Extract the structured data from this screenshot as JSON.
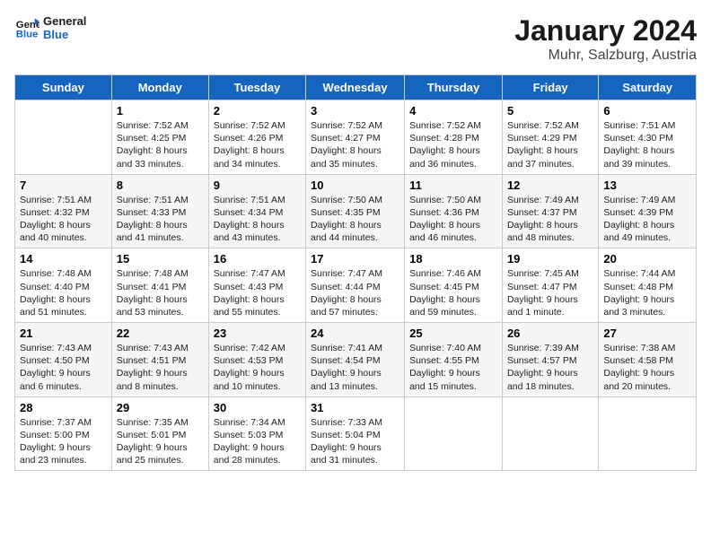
{
  "logo": {
    "general": "General",
    "blue": "Blue"
  },
  "title": "January 2024",
  "subtitle": "Muhr, Salzburg, Austria",
  "days_of_week": [
    "Sunday",
    "Monday",
    "Tuesday",
    "Wednesday",
    "Thursday",
    "Friday",
    "Saturday"
  ],
  "weeks": [
    [
      {
        "day": "",
        "sunrise": "",
        "sunset": "",
        "daylight": ""
      },
      {
        "day": "1",
        "sunrise": "Sunrise: 7:52 AM",
        "sunset": "Sunset: 4:25 PM",
        "daylight": "Daylight: 8 hours and 33 minutes."
      },
      {
        "day": "2",
        "sunrise": "Sunrise: 7:52 AM",
        "sunset": "Sunset: 4:26 PM",
        "daylight": "Daylight: 8 hours and 34 minutes."
      },
      {
        "day": "3",
        "sunrise": "Sunrise: 7:52 AM",
        "sunset": "Sunset: 4:27 PM",
        "daylight": "Daylight: 8 hours and 35 minutes."
      },
      {
        "day": "4",
        "sunrise": "Sunrise: 7:52 AM",
        "sunset": "Sunset: 4:28 PM",
        "daylight": "Daylight: 8 hours and 36 minutes."
      },
      {
        "day": "5",
        "sunrise": "Sunrise: 7:52 AM",
        "sunset": "Sunset: 4:29 PM",
        "daylight": "Daylight: 8 hours and 37 minutes."
      },
      {
        "day": "6",
        "sunrise": "Sunrise: 7:51 AM",
        "sunset": "Sunset: 4:30 PM",
        "daylight": "Daylight: 8 hours and 39 minutes."
      }
    ],
    [
      {
        "day": "7",
        "sunrise": "Sunrise: 7:51 AM",
        "sunset": "Sunset: 4:32 PM",
        "daylight": "Daylight: 8 hours and 40 minutes."
      },
      {
        "day": "8",
        "sunrise": "Sunrise: 7:51 AM",
        "sunset": "Sunset: 4:33 PM",
        "daylight": "Daylight: 8 hours and 41 minutes."
      },
      {
        "day": "9",
        "sunrise": "Sunrise: 7:51 AM",
        "sunset": "Sunset: 4:34 PM",
        "daylight": "Daylight: 8 hours and 43 minutes."
      },
      {
        "day": "10",
        "sunrise": "Sunrise: 7:50 AM",
        "sunset": "Sunset: 4:35 PM",
        "daylight": "Daylight: 8 hours and 44 minutes."
      },
      {
        "day": "11",
        "sunrise": "Sunrise: 7:50 AM",
        "sunset": "Sunset: 4:36 PM",
        "daylight": "Daylight: 8 hours and 46 minutes."
      },
      {
        "day": "12",
        "sunrise": "Sunrise: 7:49 AM",
        "sunset": "Sunset: 4:37 PM",
        "daylight": "Daylight: 8 hours and 48 minutes."
      },
      {
        "day": "13",
        "sunrise": "Sunrise: 7:49 AM",
        "sunset": "Sunset: 4:39 PM",
        "daylight": "Daylight: 8 hours and 49 minutes."
      }
    ],
    [
      {
        "day": "14",
        "sunrise": "Sunrise: 7:48 AM",
        "sunset": "Sunset: 4:40 PM",
        "daylight": "Daylight: 8 hours and 51 minutes."
      },
      {
        "day": "15",
        "sunrise": "Sunrise: 7:48 AM",
        "sunset": "Sunset: 4:41 PM",
        "daylight": "Daylight: 8 hours and 53 minutes."
      },
      {
        "day": "16",
        "sunrise": "Sunrise: 7:47 AM",
        "sunset": "Sunset: 4:43 PM",
        "daylight": "Daylight: 8 hours and 55 minutes."
      },
      {
        "day": "17",
        "sunrise": "Sunrise: 7:47 AM",
        "sunset": "Sunset: 4:44 PM",
        "daylight": "Daylight: 8 hours and 57 minutes."
      },
      {
        "day": "18",
        "sunrise": "Sunrise: 7:46 AM",
        "sunset": "Sunset: 4:45 PM",
        "daylight": "Daylight: 8 hours and 59 minutes."
      },
      {
        "day": "19",
        "sunrise": "Sunrise: 7:45 AM",
        "sunset": "Sunset: 4:47 PM",
        "daylight": "Daylight: 9 hours and 1 minute."
      },
      {
        "day": "20",
        "sunrise": "Sunrise: 7:44 AM",
        "sunset": "Sunset: 4:48 PM",
        "daylight": "Daylight: 9 hours and 3 minutes."
      }
    ],
    [
      {
        "day": "21",
        "sunrise": "Sunrise: 7:43 AM",
        "sunset": "Sunset: 4:50 PM",
        "daylight": "Daylight: 9 hours and 6 minutes."
      },
      {
        "day": "22",
        "sunrise": "Sunrise: 7:43 AM",
        "sunset": "Sunset: 4:51 PM",
        "daylight": "Daylight: 9 hours and 8 minutes."
      },
      {
        "day": "23",
        "sunrise": "Sunrise: 7:42 AM",
        "sunset": "Sunset: 4:53 PM",
        "daylight": "Daylight: 9 hours and 10 minutes."
      },
      {
        "day": "24",
        "sunrise": "Sunrise: 7:41 AM",
        "sunset": "Sunset: 4:54 PM",
        "daylight": "Daylight: 9 hours and 13 minutes."
      },
      {
        "day": "25",
        "sunrise": "Sunrise: 7:40 AM",
        "sunset": "Sunset: 4:55 PM",
        "daylight": "Daylight: 9 hours and 15 minutes."
      },
      {
        "day": "26",
        "sunrise": "Sunrise: 7:39 AM",
        "sunset": "Sunset: 4:57 PM",
        "daylight": "Daylight: 9 hours and 18 minutes."
      },
      {
        "day": "27",
        "sunrise": "Sunrise: 7:38 AM",
        "sunset": "Sunset: 4:58 PM",
        "daylight": "Daylight: 9 hours and 20 minutes."
      }
    ],
    [
      {
        "day": "28",
        "sunrise": "Sunrise: 7:37 AM",
        "sunset": "Sunset: 5:00 PM",
        "daylight": "Daylight: 9 hours and 23 minutes."
      },
      {
        "day": "29",
        "sunrise": "Sunrise: 7:35 AM",
        "sunset": "Sunset: 5:01 PM",
        "daylight": "Daylight: 9 hours and 25 minutes."
      },
      {
        "day": "30",
        "sunrise": "Sunrise: 7:34 AM",
        "sunset": "Sunset: 5:03 PM",
        "daylight": "Daylight: 9 hours and 28 minutes."
      },
      {
        "day": "31",
        "sunrise": "Sunrise: 7:33 AM",
        "sunset": "Sunset: 5:04 PM",
        "daylight": "Daylight: 9 hours and 31 minutes."
      },
      {
        "day": "",
        "sunrise": "",
        "sunset": "",
        "daylight": ""
      },
      {
        "day": "",
        "sunrise": "",
        "sunset": "",
        "daylight": ""
      },
      {
        "day": "",
        "sunrise": "",
        "sunset": "",
        "daylight": ""
      }
    ]
  ]
}
